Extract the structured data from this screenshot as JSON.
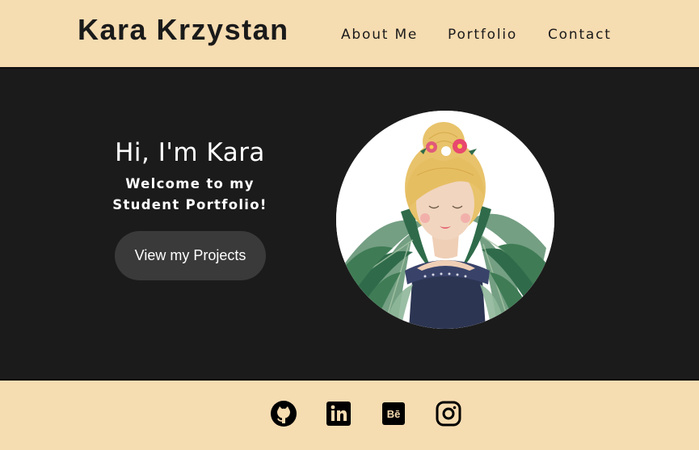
{
  "header": {
    "brand": "Kara Krzystan",
    "nav": [
      {
        "label": "About Me"
      },
      {
        "label": "Portfolio"
      },
      {
        "label": "Contact"
      }
    ]
  },
  "hero": {
    "greeting": "Hi, I'm Kara",
    "subtitle_line1": "Welcome to my",
    "subtitle_line2": "Student Portfolio!",
    "cta_label": "View my Projects"
  },
  "footer": {
    "social_icons": [
      "github-icon",
      "linkedin-icon",
      "behance-icon",
      "instagram-icon"
    ]
  },
  "colors": {
    "header_bg": "#f6dcb1",
    "hero_bg": "#1b1b1b",
    "button_bg": "#3a3a3a",
    "text_dark": "#1a1a1a"
  }
}
